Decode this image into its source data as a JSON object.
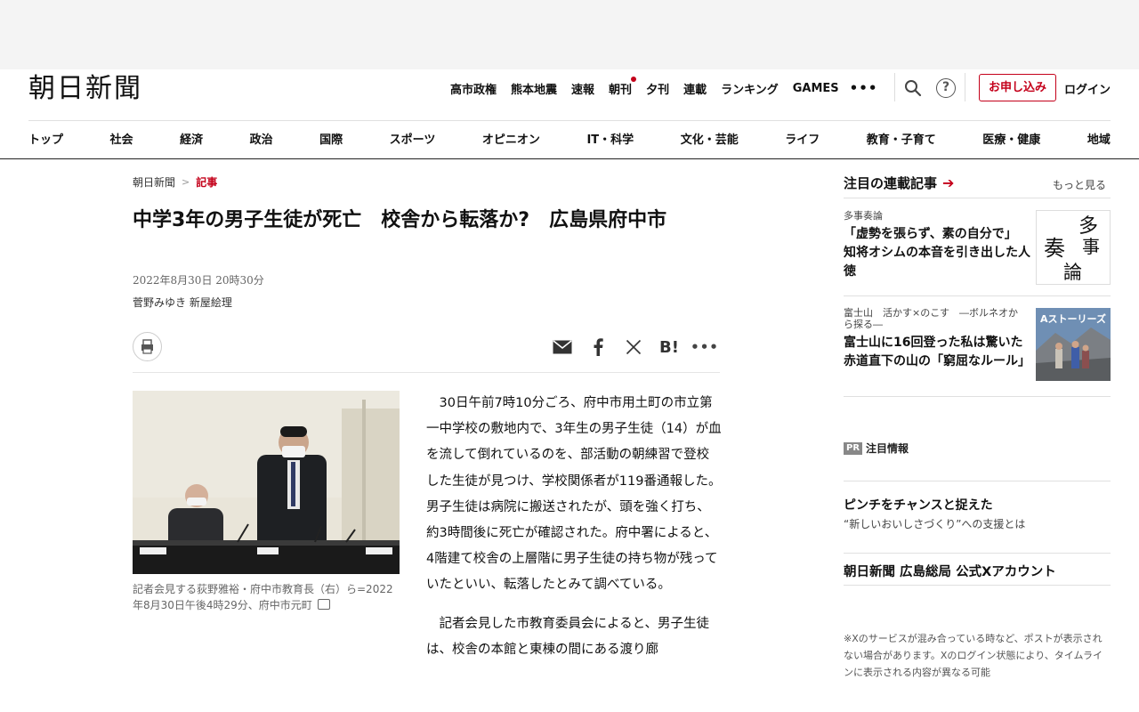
{
  "header": {
    "logo": "朝日新聞",
    "quick_nav": [
      "高市政権",
      "熊本地震",
      "速報",
      "朝刊",
      "夕刊",
      "連載",
      "ランキング",
      "GAMES"
    ],
    "signup_label": "お申し込み",
    "login_label": "ログイン",
    "accent_color": "#c4001a"
  },
  "main_nav": [
    "トップ",
    "社会",
    "経済",
    "政治",
    "国際",
    "スポーツ",
    "オピニオン",
    "IT・科学",
    "文化・芸能",
    "ライフ",
    "教育・子育て",
    "医療・健康",
    "地域"
  ],
  "breadcrumb": {
    "home": "朝日新聞",
    "separator": ">",
    "current": "記事"
  },
  "article": {
    "title": "中学3年の男子生徒が死亡　校舎から転落か?　広島県府中市",
    "date": "2022年8月30日 20時30分",
    "authors": "菅野みゆき 新屋絵理",
    "caption": "記者会見する荻野雅裕・府中市教育長（右）ら=2022年8月30日午後4時29分、府中市元町",
    "paragraphs": [
      "30日午前7時10分ごろ、府中市用土町の市立第一中学校の敷地内で、3年生の男子生徒（14）が血を流して倒れているのを、部活動の朝練習で登校した生徒が見つけ、学校関係者が119番通報した。男子生徒は病院に搬送されたが、頭を強く打ち、約3時間後に死亡が確認された。府中署によると、4階建て校舎の上層階に男子生徒の持ち物が残っていたといい、転落したとみて調べている。",
      "記者会見した市教育委員会によると、男子生徒は、校舎の本館と東棟の間にある渡り廊"
    ]
  },
  "sidebar": {
    "heading": "注目の連載記事",
    "more_label": "もっと見る",
    "items": [
      {
        "kicker": "多事奏論",
        "title": "「虚勢を張らず、素の自分で」　知将オシムの本音を引き出した人徳",
        "thumb_text": "多事奏論"
      },
      {
        "kicker": "富士山　活かす×のこす　―ボルネオから探る―",
        "title": "富士山に16回登った私は驚いた　赤道直下の山の「窮屈なルール」",
        "thumb_text": "Aストーリーズ"
      }
    ],
    "pr": {
      "badge": "PR",
      "label": "注目情報",
      "title": "ピンチをチャンスと捉えた",
      "subtitle": "“新しいおいしさづくり”への支援とは"
    },
    "x_account": {
      "title": "朝日新聞 広島総局 公式Xアカウント",
      "note": "※Xのサービスが混み合っている時など、ポストが表示されない場合があります。Xのログイン状態により、タイムラインに表示される内容が異なる可能"
    }
  }
}
